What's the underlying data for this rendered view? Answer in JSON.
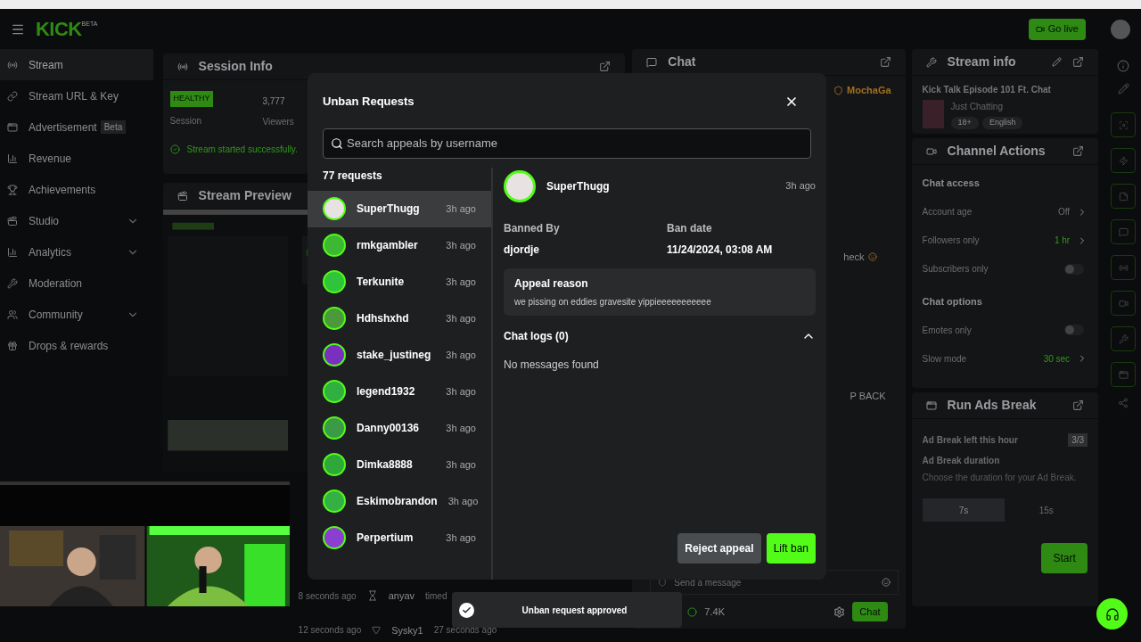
{
  "header": {
    "logo": "KICK",
    "logo_badge": "BETA",
    "go_live": "Go live"
  },
  "sidebar": {
    "items": [
      {
        "label": "Stream",
        "selected": true,
        "expandable": false
      },
      {
        "label": "Stream URL & Key",
        "selected": false,
        "expandable": false
      },
      {
        "label": "Advertisement",
        "badge": "Beta",
        "selected": false,
        "expandable": false
      },
      {
        "label": "Revenue",
        "selected": false,
        "expandable": false
      },
      {
        "label": "Achievements",
        "selected": false,
        "expandable": false
      },
      {
        "label": "Studio",
        "selected": false,
        "expandable": true
      },
      {
        "label": "Analytics",
        "selected": false,
        "expandable": true
      },
      {
        "label": "Moderation",
        "selected": false,
        "expandable": false
      },
      {
        "label": "Community",
        "selected": false,
        "expandable": true
      },
      {
        "label": "Drops & rewards",
        "selected": false,
        "expandable": false
      }
    ]
  },
  "session_info": {
    "title": "Session Info",
    "health": "HEALTHY",
    "session_label": "Session",
    "viewers": "3,777",
    "viewers_label": "Viewers",
    "status": "Stream started successfully."
  },
  "stream_preview": {
    "title": "Stream Preview"
  },
  "activity": {
    "rows": [
      {
        "time": "8 seconds ago",
        "user": "anyav",
        "detail": "timed"
      },
      {
        "time": "12 seconds ago",
        "user": "Sysky1",
        "detail": "27 seconds ago"
      }
    ]
  },
  "chat": {
    "title": "Chat",
    "fragments": [
      "MochaGa",
      "heck",
      "P BACK"
    ],
    "placeholder": "Send a message",
    "viewers": "7.4K",
    "send": "Chat"
  },
  "stream_info": {
    "title": "Stream info",
    "stream_title": "Kick Talk Episode 101 Ft. Chat",
    "category": "Just Chatting",
    "tags": [
      "18+",
      "English"
    ]
  },
  "channel_actions": {
    "title": "Channel Actions",
    "sections": [
      {
        "heading": "Chat access",
        "rows": [
          {
            "label": "Account age",
            "kind": "value",
            "value": "Off",
            "accent": false
          },
          {
            "label": "Followers only",
            "kind": "value",
            "value": "1 hr",
            "accent": true
          },
          {
            "label": "Subscribers only",
            "kind": "toggle",
            "on": false
          }
        ]
      },
      {
        "heading": "Chat options",
        "rows": [
          {
            "label": "Emotes only",
            "kind": "toggle",
            "on": false
          },
          {
            "label": "Slow mode",
            "kind": "value",
            "value": "30 sec",
            "accent": true
          }
        ]
      }
    ]
  },
  "ads": {
    "title": "Run Ads Break",
    "left_label": "Ad Break left this hour",
    "left_count": "3/3",
    "duration_label": "Ad Break duration",
    "duration_hint": "Choose the duration for your Ad Break.",
    "durations": [
      {
        "label": "7s",
        "selected": true
      },
      {
        "label": "15s",
        "selected": false
      }
    ],
    "start": "Start"
  },
  "modal": {
    "title": "Unban Requests",
    "search_placeholder": "Search appeals by username",
    "count": "77 requests",
    "requests": [
      {
        "name": "SuperThugg",
        "time": "3h ago",
        "selected": true,
        "color": "#e8e2e2"
      },
      {
        "name": "rmkgambler",
        "time": "3h ago",
        "selected": false,
        "color": "#3cb832"
      },
      {
        "name": "Terkunite",
        "time": "3h ago",
        "selected": false,
        "color": "#2fc43a"
      },
      {
        "name": "Hdhshxhd",
        "time": "3h ago",
        "selected": false,
        "color": "#4a9a3a"
      },
      {
        "name": "stake_justineg",
        "time": "3h ago",
        "selected": false,
        "color": "#7a2fc0"
      },
      {
        "name": "legend1932",
        "time": "3h ago",
        "selected": false,
        "color": "#2fb040"
      },
      {
        "name": "Danny00136",
        "time": "3h ago",
        "selected": false,
        "color": "#3a9a45"
      },
      {
        "name": "Dimka8888",
        "time": "3h ago",
        "selected": false,
        "color": "#2fa83a"
      },
      {
        "name": "Eskimobrandon",
        "time": "3h ago",
        "selected": false,
        "color": "#34b044"
      },
      {
        "name": "Perpertium",
        "time": "3h ago",
        "selected": false,
        "color": "#8a3fd0"
      }
    ],
    "detail": {
      "name": "SuperThugg",
      "time": "3h ago",
      "color": "#e8e2e2",
      "banned_by_label": "Banned By",
      "banned_by": "djordje",
      "ban_date_label": "Ban date",
      "ban_date": "11/24/2024, 03:08 AM",
      "appeal_label": "Appeal reason",
      "appeal_text": "we pissing on eddies gravesite yippieeeeeeeeeee",
      "chat_logs_label": "Chat logs (0)",
      "chat_logs_expanded": true,
      "empty": "No messages found"
    },
    "reject": "Reject appeal",
    "lift": "Lift ban"
  },
  "toast": {
    "text": "Unban request approved"
  }
}
